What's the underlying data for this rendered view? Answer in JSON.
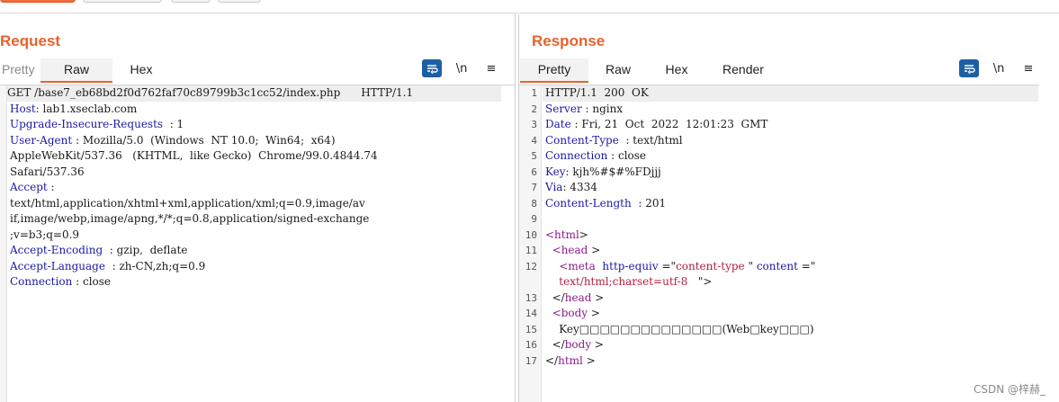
{
  "request": {
    "title": "Request",
    "tabs": [
      "Pretty",
      "Raw",
      "Hex"
    ],
    "active_tab": "Raw",
    "tools": [
      "wrap",
      "\\n",
      "≡"
    ],
    "lines": [
      "GET /base7_eb68bd2f0d762faf70c89799b3c1cc52/index.php      HTTP/1.1",
      "Host: lab1.xseclab.com",
      "Upgrade-Insecure-Requests  : 1",
      "User-Agent : Mozilla/5.0  (Windows  NT 10.0;  Win64;  x64)",
      "AppleWebKit/537.36   (KHTML,  like Gecko)  Chrome/99.0.4844.74",
      "Safari/537.36",
      "Accept :",
      "text/html,application/xhtml+xml,application/xml;q=0.9,image/av",
      "if,image/webp,image/apng,*/*;q=0.8,application/signed-exchange",
      ";v=b3;q=0.9",
      "Accept-Encoding  : gzip,  deflate",
      "Accept-Language  : zh-CN,zh;q=0.9",
      "Connection : close"
    ]
  },
  "response": {
    "title": "Response",
    "tabs": [
      "Pretty",
      "Raw",
      "Hex",
      "Render"
    ],
    "active_tab": "Pretty",
    "tools": [
      "wrap",
      "\\n",
      "≡"
    ],
    "line_numbers": [
      "1",
      "2",
      "3",
      "4",
      "5",
      "6",
      "7",
      "8",
      "9",
      "10",
      "11",
      "12",
      "",
      "13",
      "14",
      "15",
      "16",
      "17"
    ],
    "lines": [
      "HTTP/1.1  200  OK",
      "Server : nginx",
      "Date : Fri, 21  Oct  2022  12:01:23  GMT",
      "Content-Type  : text/html",
      "Connection : close",
      "Key: kjh%#$#%FDjjj",
      "Via: 4334",
      "Content-Length  : 201",
      "",
      "<html>",
      "  <head>",
      "    <meta  http-equiv =\"content-type \" content =\"",
      "    text/html;charset=utf-8   \">",
      "  </head>",
      "  <body>",
      "    Key□□□□□□□□□□□□□□(Web□key□□□)",
      "  </body>",
      "</html>"
    ]
  },
  "view_selector": [
    "side-by-side",
    "horizontal",
    "tabs"
  ],
  "watermark": "CSDN @梓赫_"
}
